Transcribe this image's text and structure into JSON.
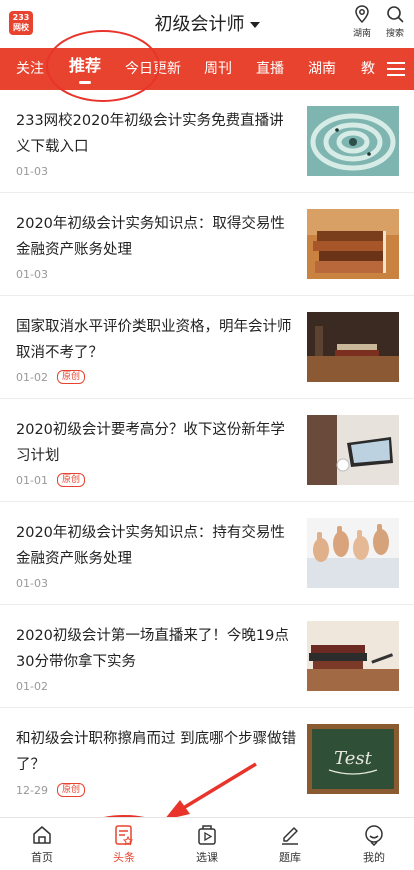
{
  "header": {
    "logo_line1": "233",
    "logo_line2": "网校",
    "title": "初级会计师",
    "location_label": "湖南",
    "search_label": "搜索"
  },
  "tabs": [
    "关注",
    "推荐",
    "今日更新",
    "周刊",
    "直播",
    "湖南",
    "教"
  ],
  "active_tab": "推荐",
  "articles": [
    {
      "title": "233网校2020年初级会计实务免费直播讲义下载入口",
      "date": "01-03",
      "badge": ""
    },
    {
      "title": "2020年初级会计实务知识点：取得交易性金融资产账务处理",
      "date": "01-03",
      "badge": ""
    },
    {
      "title": "国家取消水平评价类职业资格，明年会计师取消不考了？",
      "date": "01-02",
      "badge": "原创"
    },
    {
      "title": "2020初级会计要考高分？收下这份新年学习计划",
      "date": "01-01",
      "badge": "原创"
    },
    {
      "title": "2020年初级会计实务知识点：持有交易性金融资产账务处理",
      "date": "01-03",
      "badge": ""
    },
    {
      "title": "2020初级会计第一场直播来了！今晚19点30分带你拿下实务",
      "date": "01-02",
      "badge": ""
    },
    {
      "title": "和初级会计职称擦肩而过 到底哪个步骤做错了？",
      "date": "12-29",
      "badge": "原创"
    }
  ],
  "thumb_text": "Test",
  "bottom_nav": [
    {
      "label": "首页",
      "icon": "home-icon"
    },
    {
      "label": "头条",
      "icon": "headline-icon"
    },
    {
      "label": "选课",
      "icon": "course-icon"
    },
    {
      "label": "题库",
      "icon": "question-bank-icon"
    },
    {
      "label": "我的",
      "icon": "profile-icon"
    }
  ],
  "active_nav": "头条",
  "colors": {
    "accent": "#e8432f",
    "annotation": "#e8342a"
  }
}
